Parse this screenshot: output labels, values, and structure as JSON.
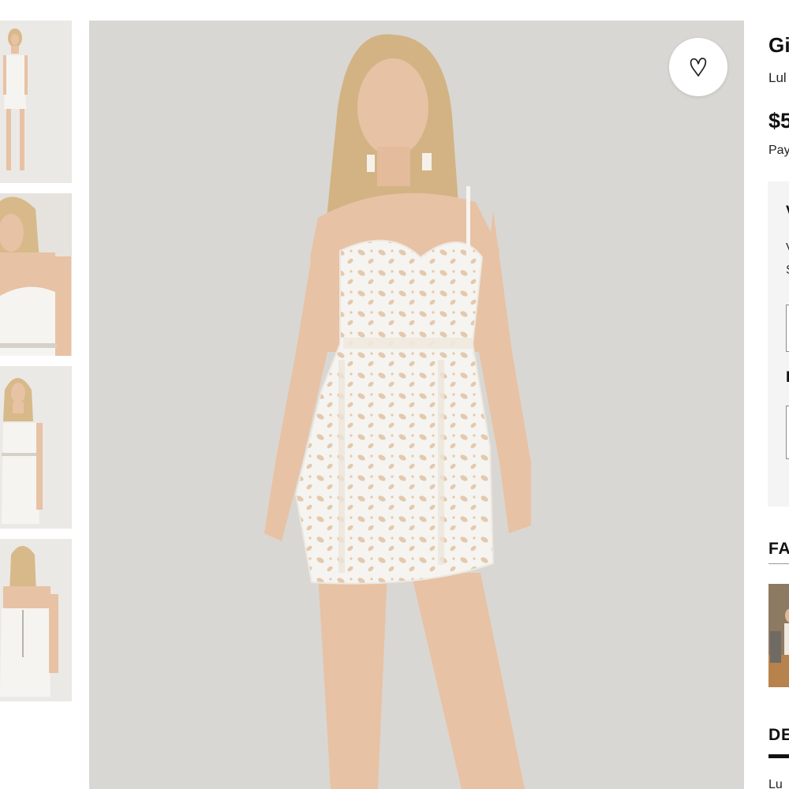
{
  "product": {
    "title": "Gi",
    "brand": "Lul",
    "price": "$5",
    "pay_note": "Pay"
  },
  "options_panel": {
    "heading_1": "V",
    "line_1": "V",
    "line_2": "S",
    "heading_2": "I"
  },
  "sections": {
    "favorites_heading": "FA",
    "description_heading": "DE",
    "description_text": "Lu"
  },
  "icons": {
    "wishlist": "heart-outline-icon"
  },
  "colors": {
    "background": "#ffffff",
    "photo_backdrop": "#d9d7d3",
    "dress": "#f6f4f0",
    "skin": "#e8c2a4",
    "options_panel": "#f4f4f4"
  },
  "gallery": {
    "thumbnail_count": 4,
    "selected_thumbnail": 1
  }
}
